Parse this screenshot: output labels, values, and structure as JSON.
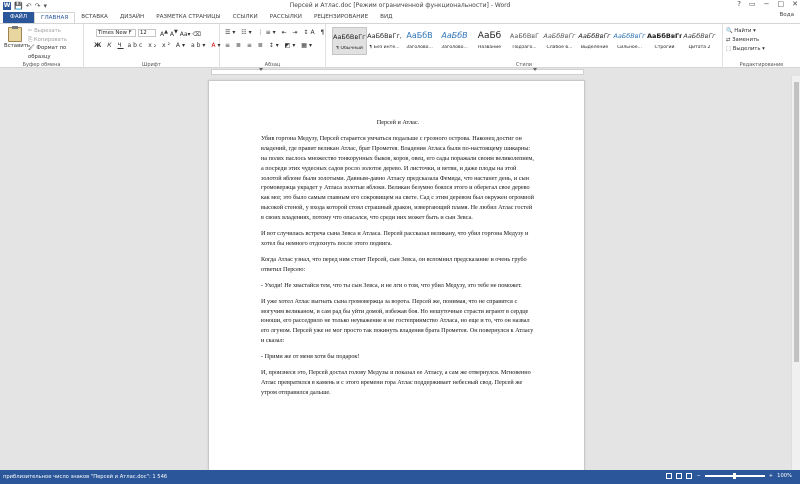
{
  "window": {
    "title": "Персей и Атлас.doc [Режим ограниченной функциональности] - Word",
    "user": "Вода",
    "controls": [
      "?",
      "▭",
      "−",
      "□",
      "✕"
    ]
  },
  "tabs": [
    "ФАЙЛ",
    "ГЛАВНАЯ",
    "ВСТАВКА",
    "ДИЗАЙН",
    "РАЗМЕТКА СТРАНИЦЫ",
    "ССЫЛКИ",
    "РАССЫЛКИ",
    "РЕЦЕНЗИРОВАНИЕ",
    "ВИД"
  ],
  "clipboard": {
    "paste": "Вставить",
    "cut": "Вырезать",
    "copy": "Копировать",
    "format": "Формат по образцу",
    "label": "Буфер обмена"
  },
  "font": {
    "name": "Times New F",
    "size": "12",
    "label": "Шрифт",
    "paragraph_label": "Абзац"
  },
  "styles": {
    "label": "Стили",
    "items": [
      {
        "preview": "АаБбВвГг,",
        "name": "¶ Обычный"
      },
      {
        "preview": "АаБбВвГг,",
        "name": "¶ Без инте..."
      },
      {
        "preview": "АаБбВ",
        "name": "Заголово..."
      },
      {
        "preview": "АаБбВ",
        "name": "Заголово..."
      },
      {
        "preview": "АаБб",
        "name": "Название"
      },
      {
        "preview": "АаБбВвГ",
        "name": "Подзаго..."
      },
      {
        "preview": "АаБбВвГг",
        "name": "Слабое в..."
      },
      {
        "preview": "АаБбВвГг",
        "name": "Выделение"
      },
      {
        "preview": "АаБбВвГг",
        "name": "Сильное..."
      },
      {
        "preview": "АаБбВвГг",
        "name": "Строгий"
      },
      {
        "preview": "АаБбВвГг",
        "name": "Цитата 2"
      }
    ]
  },
  "editing": {
    "find": "Найти",
    "replace": "Заменить",
    "select": "Выделить",
    "label": "Редактирование"
  },
  "document": {
    "title": "Персей и Атлас.",
    "paragraphs": [
      "Убив горгона Медузу, Персей старается умчаться подальше с грозного острова. Наконец достиг он владений, где правит великан Атлас, брат Прометея. Владения Атласа были по-настоящему шикарны: на полях паслось множество тонкорунных быков, коров, овец, его сады поражали своим великолепием, а посреди этих чудесных садов росло золотое дерево. И листочки, и ветви, и даже плоды на этой золотой яблоне были золотыми. Давным-давно Атласу предсказала Фемида, что настанет день, и сын громовержца украдет у Атласа золотые яблоки. Великан безумно боялся этого и оберегал свое дерево как мог, это было самым главным его сокровищем на свете. Сад с этим деревом был окружен огромной высокой стеной, у входа которой стоял страшный дракон, извергающий пламя. Не любил Атлас гостей в своих владениях, потому что опасался, что среди них может быть и сын Зевса.",
      "И вот случилась встреча сына Зевса и Атласа. Персей рассказал великану, что убил горгона Медузу и хотел бы немного отдохнуть после этого подвига.",
      "Когда Атлас узнал, что перед ним стоит Персей, сын Зевса, он вспомнил предсказание и очень грубо ответил Персею:",
      "- Уходи! Не хвастайся тем, что ты сын Зевса, и не лги о том, что убил Медузу, это тебе не поможет.",
      "И уже хотел Атлас выгнать сына громовержца за ворота. Персей же, понимая, что не справится с могучим великаном, и сам рад бы уйти домой, избежав боя. Но нешуточные страсти играют в сердце юноши, его расседрило не только неуважение и не гостеприимство Атласа, но еще и то, что он назвал его лгуном. Персей уже не мог просто так покинуть владения брата Прометея. Он повернулся к Атласу и сказал:",
      "- Прими же от меня хотя бы подарок!",
      "И, произнеся это, Персей достал голову Медузы и показал ее Атласу, а сам же отвернулся. Мгновенно Атлас превратился в камень и с этого времени гора Атлас поддерживает небесный свод. Персей же утром отправился дальше."
    ]
  },
  "status": {
    "words": "приблизительное число знаков \"Персей и Атлас.doc\": 1 546",
    "zoom": "100%"
  }
}
